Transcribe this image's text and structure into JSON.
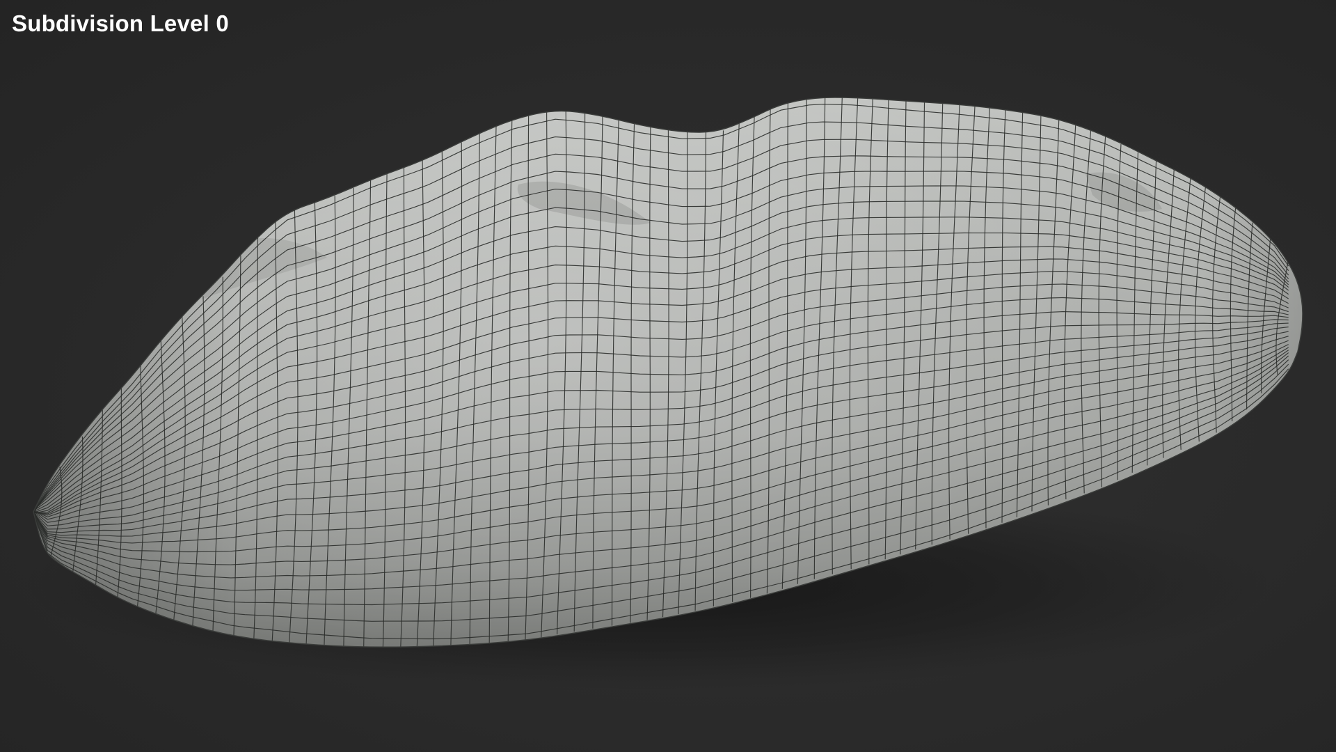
{
  "viewport": {
    "label": "Subdivision Level 0",
    "background_color": "#2b2b2b",
    "label_color": "#ffffff"
  },
  "model": {
    "surface_color": "#a9aba8",
    "wire_color": "#2a2c2a",
    "shading": "smooth-shaded-with-wireframe"
  }
}
